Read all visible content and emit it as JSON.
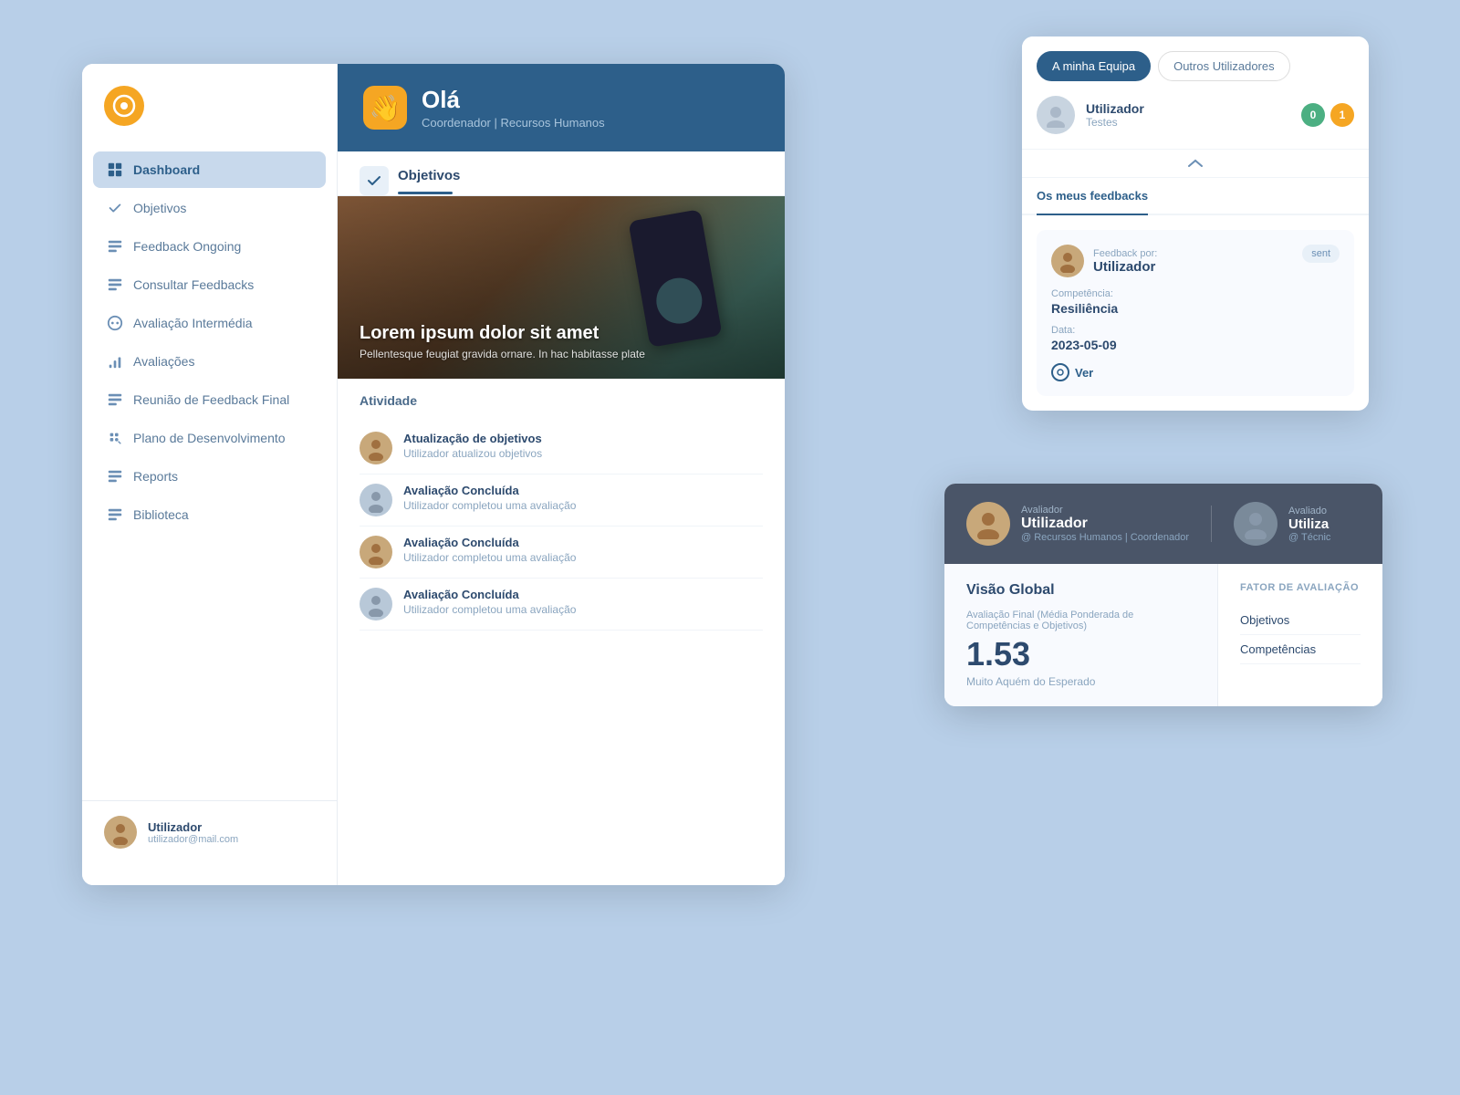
{
  "app": {
    "logo_alt": "App Logo"
  },
  "sidebar": {
    "nav_items": [
      {
        "id": "dashboard",
        "label": "Dashboard",
        "active": true
      },
      {
        "id": "objetivos",
        "label": "Objetivos",
        "active": false
      },
      {
        "id": "feedback-ongoing",
        "label": "Feedback Ongoing",
        "active": false
      },
      {
        "id": "consultar-feedbacks",
        "label": "Consultar Feedbacks",
        "active": false
      },
      {
        "id": "avaliacao-intermedia",
        "label": "Avaliação Intermédia",
        "active": false
      },
      {
        "id": "avaliacoes",
        "label": "Avaliações",
        "active": false
      },
      {
        "id": "reuniao-feedback",
        "label": "Reunião de Feedback Final",
        "active": false
      },
      {
        "id": "plano-desenvolvimento",
        "label": "Plano de Desenvolvimento",
        "active": false
      },
      {
        "id": "reports",
        "label": "Reports",
        "active": false
      },
      {
        "id": "biblioteca",
        "label": "Biblioteca",
        "active": false
      }
    ],
    "user": {
      "name": "Utilizador",
      "email": "utilizador@mail.com"
    }
  },
  "header": {
    "greeting": "Olá",
    "subtitle": "Coordenador | Recursos Humanos"
  },
  "tabs": {
    "objetivos_label": "Objetivos"
  },
  "hero": {
    "title": "Lorem ipsum dolor sit amet",
    "description": "Pellentesque feugiat gravida ornare. In hac habitasse plate"
  },
  "activity": {
    "section_title": "Atividade",
    "items": [
      {
        "title": "Atualização de objetivos",
        "sub": "Utilizador atualizou objetivos",
        "type": "person"
      },
      {
        "title": "Avaliação Concluída",
        "sub": "Utilizador completou uma avaliação",
        "type": "grey"
      },
      {
        "title": "Avaliação Concluída",
        "sub": "Utilizador completou uma avaliação",
        "type": "person"
      },
      {
        "title": "Avaliação Concluída",
        "sub": "Utilizador completou uma avaliação",
        "type": "grey"
      }
    ]
  },
  "feedback_panel": {
    "tab_my_team": "A minha Equipa",
    "tab_other_users": "Outros Utilizadores",
    "user_name": "Utilizador",
    "user_testes": "Testes",
    "badge_green": "0",
    "badge_orange": "1",
    "subtab_feedbacks": "Os meus feedbacks",
    "card": {
      "by_label": "Feedback por:",
      "by_name": "Utilizador",
      "status": "sent",
      "competencia_label": "Competência:",
      "competencia_value": "Resiliência",
      "data_label": "Data:",
      "data_value": "2023-05-09",
      "ver_btn": "Ver"
    }
  },
  "evaluation_panel": {
    "avaliador_label": "Avaliador",
    "avaliador_name": "Utilizador",
    "avaliador_dept": "@ Recursos Humanos | Coordenador",
    "avaliado_label": "Avaliado",
    "avaliado_name": "Utiliza",
    "avaliado_dept": "@ Técnic",
    "visao_global_title": "Visão Global",
    "score_label": "Avaliação Final (Média Ponderada de Competências e Objetivos)",
    "score": "1.53",
    "score_desc": "Muito Aquém do Esperado",
    "fator_title": "FATOR DE AVALIAÇÃO",
    "fator_items": [
      "Objetivos",
      "Competências"
    ]
  }
}
